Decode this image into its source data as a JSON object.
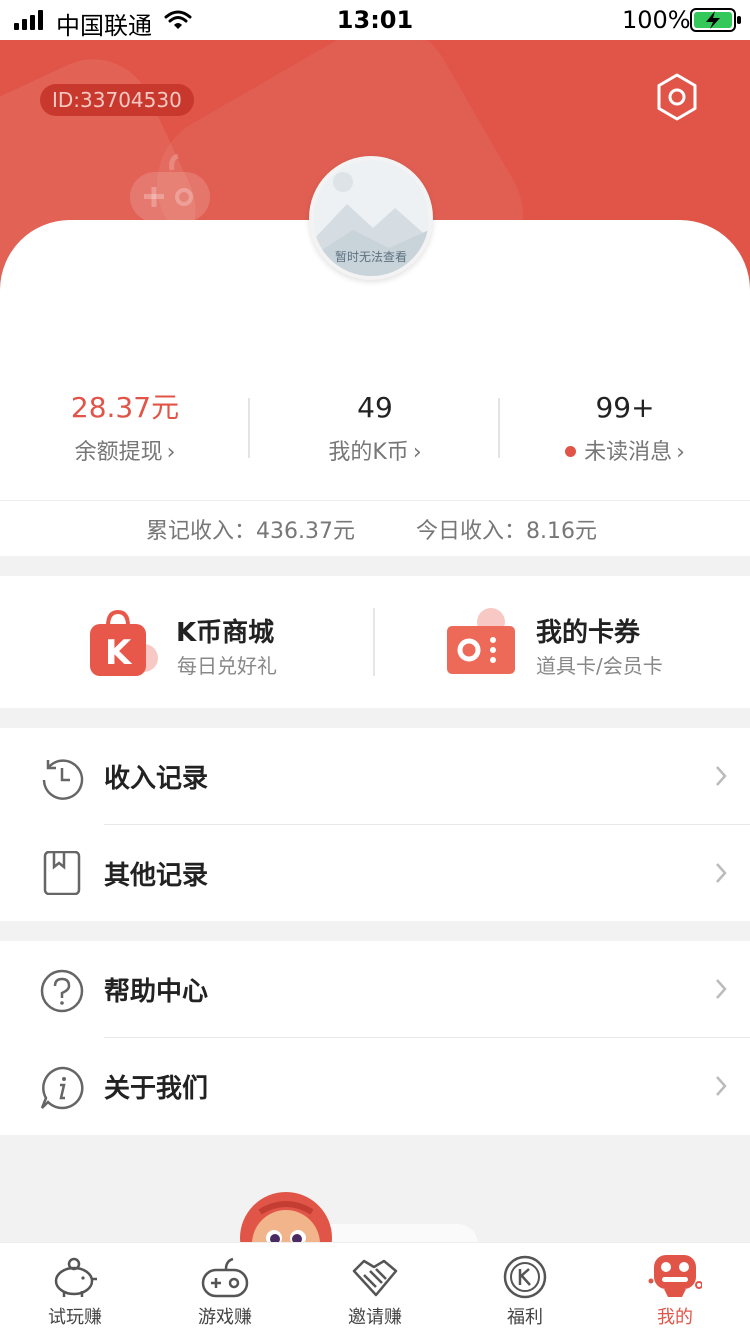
{
  "status_bar": {
    "carrier": "中国联通",
    "time": "13:01",
    "battery": "100%"
  },
  "header": {
    "user_id": "ID:33704530"
  },
  "avatar": {
    "placeholder_text": "暂时无法查看"
  },
  "stats": [
    {
      "value": "28.37元",
      "label": "余额提现",
      "highlight_color": "#e05548"
    },
    {
      "value": "49",
      "label": "我的K币"
    },
    {
      "value": "99+",
      "label": "未读消息"
    }
  ],
  "income": {
    "total": "累记收入：436.37元",
    "today": "今日收入：8.16元"
  },
  "promo": {
    "shop": {
      "title": "K币商城",
      "subtitle": "每日兑好礼"
    },
    "coupon": {
      "title": "我的卡券",
      "subtitle": "道具卡/会员卡"
    }
  },
  "menu_group1": [
    {
      "label": "收入记录",
      "icon": "history-icon"
    },
    {
      "label": "其他记录",
      "icon": "bookmark-book-icon"
    }
  ],
  "menu_group2": [
    {
      "label": "帮助中心",
      "icon": "help-icon"
    },
    {
      "label": "关于我们",
      "icon": "info-icon"
    }
  ],
  "tabs": [
    {
      "label": "试玩赚",
      "icon": "piggy-bank-icon"
    },
    {
      "label": "游戏赚",
      "icon": "gamepad-icon"
    },
    {
      "label": "邀请赚",
      "icon": "handshake-icon"
    },
    {
      "label": "福利",
      "icon": "k-coin-icon"
    },
    {
      "label": "我的",
      "icon": "robot-face-icon",
      "active": true
    }
  ],
  "colors": {
    "brand": "#e05548",
    "background": "#f2f2f2"
  }
}
